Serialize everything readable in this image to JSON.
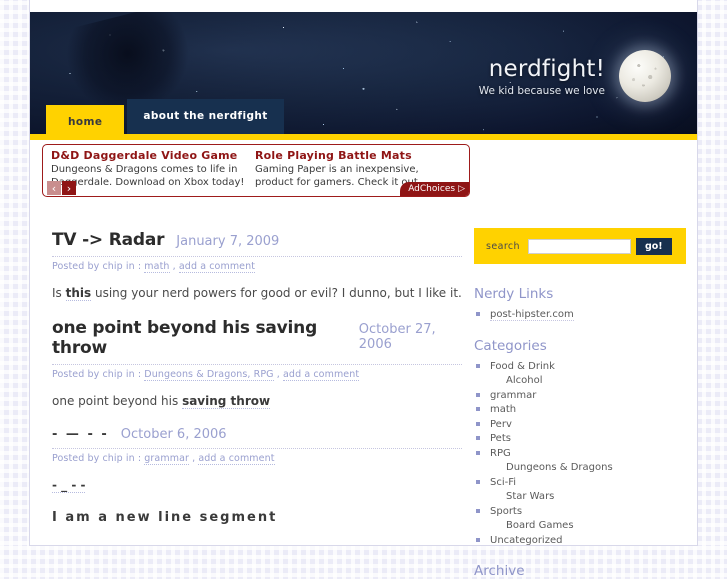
{
  "site": {
    "title": "nerdfight!",
    "tagline": "We kid because we love"
  },
  "nav": {
    "tabs": [
      {
        "label": "home",
        "active": true
      },
      {
        "label": "about the nerdfight",
        "active": false
      }
    ]
  },
  "ad": {
    "items": [
      {
        "title": "D&D Daggerdale Video Game",
        "text": "Dungeons & Dragons comes to life in Daggerdale. Download on Xbox today!"
      },
      {
        "title": "Role Playing Battle Mats",
        "text": "Gaming Paper is an inexpensive, product for gamers. Check it out."
      }
    ],
    "prev_icon": "‹",
    "next_icon": "›",
    "adchoices_label": "AdChoices",
    "adchoices_icon": "▷"
  },
  "posts": [
    {
      "title": "TV -> Radar",
      "date": "January 7, 2009",
      "meta_prefix": "Posted by chip in :",
      "categories": "math",
      "comment_link": "add a comment",
      "body_before": "Is ",
      "body_link": "this",
      "body_after": " using your nerd powers for good or evil? I dunno, but I like it."
    },
    {
      "title": "one point beyond his saving throw",
      "date": "October 27, 2006",
      "meta_prefix": "Posted by chip in :",
      "categories": "Dungeons & Dragons, RPG",
      "comment_link": "add a comment",
      "body_before": "one point beyond his ",
      "body_link": "saving throw",
      "body_after": ""
    },
    {
      "title": "- — - -",
      "date": "October 6, 2006",
      "meta_prefix": "Posted by chip in :",
      "categories": "grammar",
      "comment_link": "add a comment",
      "body_before": "",
      "body_link": "- _ - -",
      "body_after": ""
    },
    {
      "title": "I am a new line segment",
      "date": "",
      "meta_prefix": "",
      "categories": "",
      "comment_link": "",
      "body_before": "",
      "body_link": "",
      "body_after": ""
    }
  ],
  "search": {
    "label": "search",
    "value": "",
    "placeholder": "",
    "go_label": "go!"
  },
  "sidebar": {
    "links_widget": {
      "title": "Nerdy Links",
      "items": [
        {
          "label": "post-hipster.com",
          "sub": false,
          "dotted": true
        }
      ]
    },
    "categories_widget": {
      "title": "Categories",
      "items": [
        {
          "label": "Food & Drink",
          "sub": false,
          "dotted": false
        },
        {
          "label": "Alcohol",
          "sub": true,
          "dotted": false
        },
        {
          "label": "grammar",
          "sub": false,
          "dotted": false
        },
        {
          "label": "math",
          "sub": false,
          "dotted": false
        },
        {
          "label": "Perv",
          "sub": false,
          "dotted": false
        },
        {
          "label": "Pets",
          "sub": false,
          "dotted": false
        },
        {
          "label": "RPG",
          "sub": false,
          "dotted": false
        },
        {
          "label": "Dungeons & Dragons",
          "sub": true,
          "dotted": false
        },
        {
          "label": "Sci-Fi",
          "sub": false,
          "dotted": false
        },
        {
          "label": "Star Wars",
          "sub": true,
          "dotted": false
        },
        {
          "label": "Sports",
          "sub": false,
          "dotted": false
        },
        {
          "label": "Board Games",
          "sub": true,
          "dotted": false
        },
        {
          "label": "Uncategorized",
          "sub": false,
          "dotted": false
        }
      ]
    },
    "archive_widget": {
      "title": "Archive",
      "items": []
    }
  }
}
